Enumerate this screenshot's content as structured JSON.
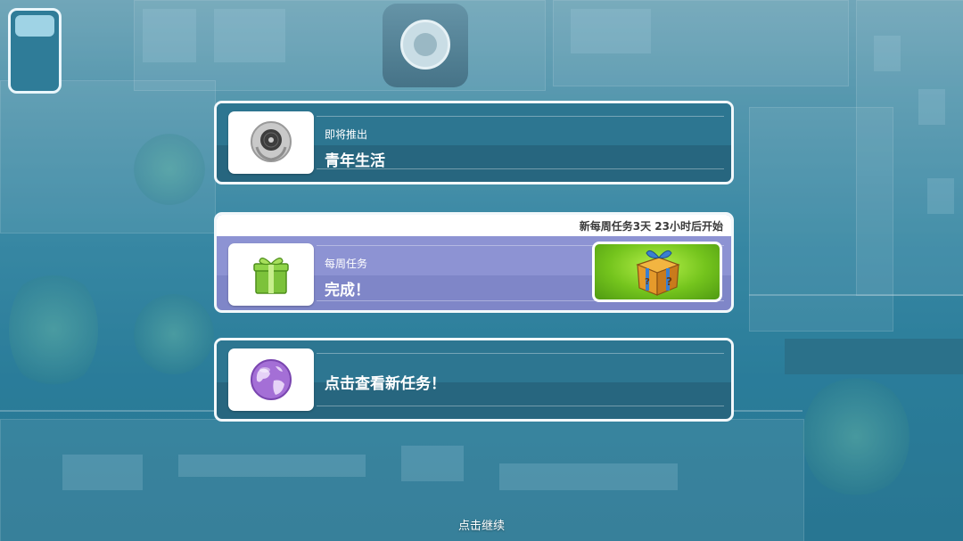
{
  "cards": {
    "coming_soon": {
      "subtitle": "即将推出",
      "title": "青年生活",
      "icon": "vinyl-record-icon"
    },
    "weekly": {
      "countdown": "新每周任务3天 23小时后开始",
      "subtitle": "每周任务",
      "title": "完成！",
      "icon": "green-gift-icon",
      "reward_icon": "mystery-gift-box-icon"
    },
    "new_tasks": {
      "title": "点击查看新任务！",
      "icon": "purple-globe-icon"
    }
  },
  "footer": {
    "continue": "点击继续"
  },
  "colors": {
    "card_dark": "#27667f",
    "card_weekly": "#7f86c8",
    "reward_green": "#74c41d",
    "border": "#f2f8fb"
  }
}
